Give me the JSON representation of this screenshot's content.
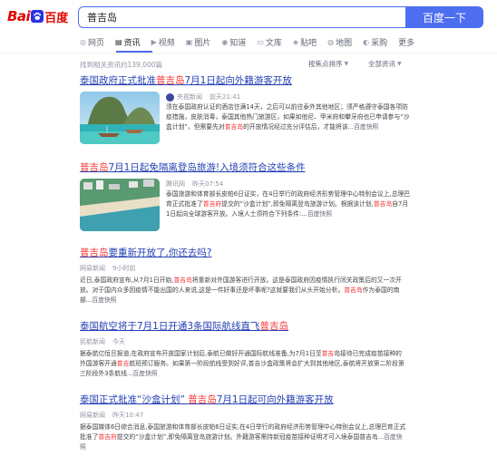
{
  "header": {
    "logo_text_left": "Bai",
    "logo_text_right": "百度",
    "query": "普吉岛",
    "search_button": "百度一下"
  },
  "tabs": [
    {
      "label": "网页",
      "icon": "web-icon"
    },
    {
      "label": "资讯",
      "icon": "news-icon",
      "active": true
    },
    {
      "label": "视频",
      "icon": "video-icon"
    },
    {
      "label": "图片",
      "icon": "image-icon"
    },
    {
      "label": "知道",
      "icon": "zhidao-icon"
    },
    {
      "label": "文库",
      "icon": "wenku-icon"
    },
    {
      "label": "贴吧",
      "icon": "tieba-icon"
    },
    {
      "label": "地图",
      "icon": "map-icon"
    },
    {
      "label": "采购",
      "icon": "shopping-icon"
    },
    {
      "label": "更多",
      "icon": ""
    }
  ],
  "stats": "找到相关资讯约139,000篇",
  "tools": {
    "sort": "按焦点排序",
    "filter": "全部资讯"
  },
  "results": [
    {
      "title_pre": "泰国政府正式批准",
      "title_em": "普吉岛",
      "title_post": "7月1日起向外籍游客开放",
      "source": "央视新闻",
      "time": "前天21:41",
      "body_pre": "须在泰国政府认证的酒店住满14天，之后可以前往泰外其他地区；须严格遵守泰国各项防疫措施，皮肤消毒，泰国其他热门旅游区，如果如他尼、甲米府和攀牙府也已申请参与“沙盒计划”，但需要先对",
      "body_em": "普吉岛",
      "body_post": "的开放情况经过充分评估后，才能将该...",
      "snapshot": "百度快照"
    },
    {
      "title_pre": "",
      "title_em": "普吉岛",
      "title_post": "7月1日起免隔离登岛旅游!入境须符合这些条件",
      "source": "腾讯网",
      "time": "昨天07:54",
      "body_pre": "泰国旅游和体育部长皮帕6日证实，在4日举行的政府经济形势管理中心特别会议上,总理巴育正式批准了",
      "body_em": "普吉府",
      "body_mid": "提交的“沙盒计划”,即免隔离登岛旅游计划。根据该计划,",
      "body_em2": "普吉岛",
      "body_post": "自7月1日起向全球游客开放。入境人士须符合下列条件:...",
      "snapshot": "百度快照"
    },
    {
      "title_pre": "",
      "title_em": "普吉岛",
      "title_post": "要重新开放了,你还去吗?",
      "source": "网易新闻",
      "time": "9小时前",
      "body_pre": "近日,泰国政府宣布,从7月1日开始,",
      "body_em": "普吉岛",
      "body_mid": "将重新对外国游客进行开放。这是泰国政府因疫情执行闭关政策后的又一次开放。对于国内众多因疫情不能出国的人来说,这是一件好事还是坏事呢?这就要我们从头开始分析。",
      "body_em2": "普吉岛",
      "body_post": "作为泰国的南部...",
      "snapshot": "百度快照"
    },
    {
      "title_pre": "泰国航空将于7月1日开通3条国际航线直飞",
      "title_em": "普吉岛",
      "title_post": "",
      "source": "民航新闻",
      "time": "今天",
      "body_pre": "据泰航亿恒旦报道,在政府宣布开放国家计划后,泰航已做好开通国际航线准备,为7月1日至",
      "body_em": "普吉",
      "body_mid": "岛接待已完成疫苗接种的外国游客开通",
      "body_em2": "普吉",
      "body_post": "航班预订服务。如果第一阶段航线受到好评,普吉沙盒政策将会扩大到其他地区,泰航将开放第二阶段第三阶段外3条航线...",
      "snapshot": "百度快照"
    },
    {
      "title_pre": "泰国正式批准“沙盒计划” ",
      "title_em": "普吉岛",
      "title_post": "7月1日起可向外籍游客开放",
      "source": "网易新闻",
      "time": "昨天10:47",
      "body_pre": "据泰国媒体6日综合消息,泰国旅游和体育部长皮帕6日证实,在4日举行的政府经济形势管理中心特别会议上,总理巴育正式批准了",
      "body_em": "普吉府",
      "body_post": "提交的“沙盒计划”,即免隔离登岛旅游计划。外籍游客需持新冠疫苗接种证明才可入境泰国普吉岛...",
      "snapshot": "百度快照"
    }
  ],
  "colors": {
    "accent": "#4e6ef2",
    "link": "#2440b3",
    "highlight": "#f73131",
    "logo": "#e10601"
  }
}
